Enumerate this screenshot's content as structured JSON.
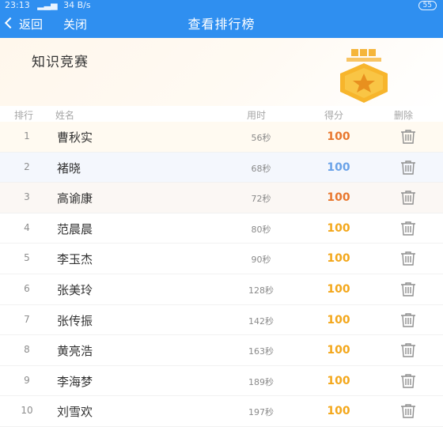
{
  "status_bar": {
    "time": "23:13",
    "network": "34 B/s",
    "battery": "55"
  },
  "nav": {
    "back_label": "返回",
    "close_label": "关闭",
    "title": "查看排行榜"
  },
  "banner": {
    "title": "知识竞赛"
  },
  "table": {
    "headers": {
      "rank": "排行",
      "name": "姓名",
      "time": "用时",
      "score": "得分",
      "delete": "删除"
    },
    "rows": [
      {
        "rank": "1",
        "name": "曹秋实",
        "time": "56秒",
        "score": "100",
        "score_color": "#e8772e"
      },
      {
        "rank": "2",
        "name": "褚晓",
        "time": "68秒",
        "score": "100",
        "score_color": "#6aa2e8"
      },
      {
        "rank": "3",
        "name": "高谕康",
        "time": "72秒",
        "score": "100",
        "score_color": "#e8772e"
      },
      {
        "rank": "4",
        "name": "范晨晨",
        "time": "80秒",
        "score": "100",
        "score_color": "#f3a71b"
      },
      {
        "rank": "5",
        "name": "李玉杰",
        "time": "90秒",
        "score": "100",
        "score_color": "#f3a71b"
      },
      {
        "rank": "6",
        "name": "张美玲",
        "time": "128秒",
        "score": "100",
        "score_color": "#f3a71b"
      },
      {
        "rank": "7",
        "name": "张传振",
        "time": "142秒",
        "score": "100",
        "score_color": "#f3a71b"
      },
      {
        "rank": "8",
        "name": "黄亮浩",
        "time": "163秒",
        "score": "100",
        "score_color": "#f3a71b"
      },
      {
        "rank": "9",
        "name": "李海梦",
        "time": "189秒",
        "score": "100",
        "score_color": "#f3a71b"
      },
      {
        "rank": "10",
        "name": "刘雪欢",
        "time": "197秒",
        "score": "100",
        "score_color": "#f3a71b"
      }
    ]
  },
  "icons": {
    "back": "chevron-left-icon",
    "medal": "medal-star-icon",
    "delete": "trash-icon"
  },
  "colors": {
    "primary": "#2f8ff0",
    "medal_gold": "#f7b52c"
  }
}
